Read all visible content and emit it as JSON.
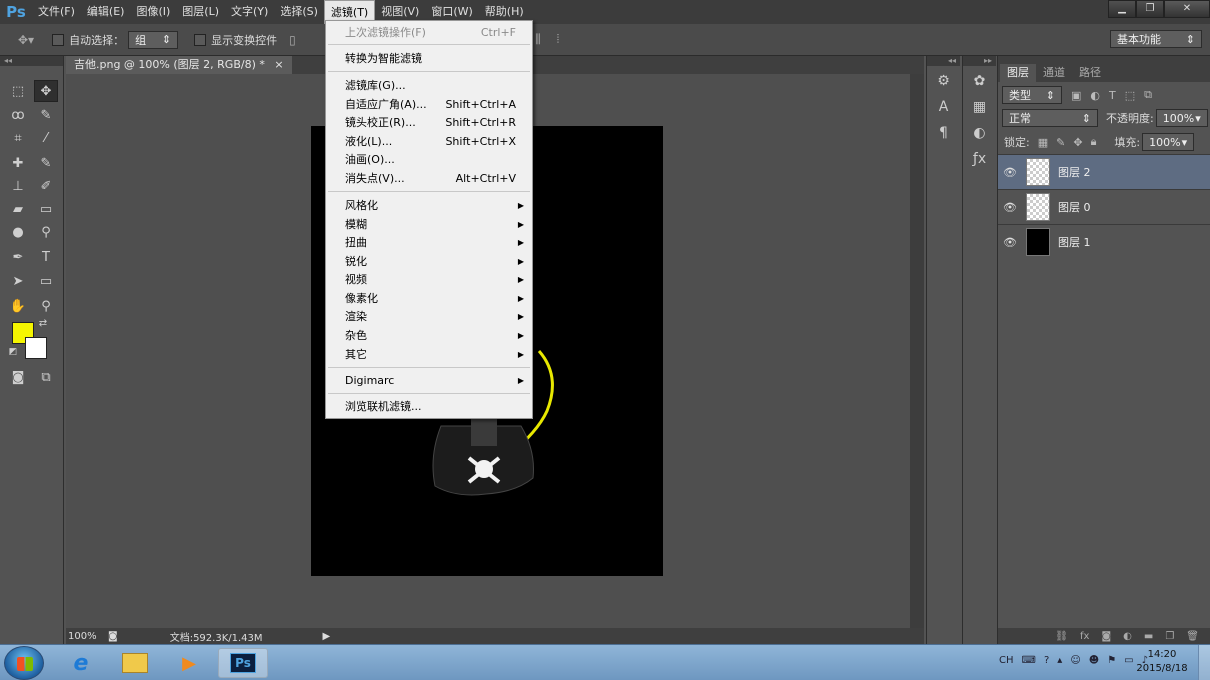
{
  "app": {
    "logo": "Ps"
  },
  "menubar": {
    "items": [
      "文件(F)",
      "编辑(E)",
      "图像(I)",
      "图层(L)",
      "文字(Y)",
      "选择(S)",
      "滤镜(T)",
      "视图(V)",
      "窗口(W)",
      "帮助(H)"
    ],
    "active_index": 6
  },
  "options": {
    "auto_select_label": "自动选择：",
    "auto_select_value": "组",
    "show_transform_label": "显示变换控件",
    "workspace": "基本功能"
  },
  "document": {
    "tab_title": "吉他.png @ 100% (图层 2, RGB/8) *"
  },
  "status": {
    "zoom": "100%",
    "doc_size": "文档:592.3K/1.43M"
  },
  "filter_menu": {
    "last_filter": {
      "label": "上次滤镜操作(F)",
      "shortcut": "Ctrl+F"
    },
    "convert_smart": "转换为智能滤镜",
    "group1": [
      {
        "label": "滤镜库(G)...",
        "shortcut": ""
      },
      {
        "label": "自适应广角(A)...",
        "shortcut": "Shift+Ctrl+A"
      },
      {
        "label": "镜头校正(R)...",
        "shortcut": "Shift+Ctrl+R"
      },
      {
        "label": "液化(L)...",
        "shortcut": "Shift+Ctrl+X"
      },
      {
        "label": "油画(O)...",
        "shortcut": ""
      },
      {
        "label": "消失点(V)...",
        "shortcut": "Alt+Ctrl+V"
      }
    ],
    "submenus": [
      "风格化",
      "模糊",
      "扭曲",
      "锐化",
      "视频",
      "像素化",
      "渲染",
      "杂色",
      "其它"
    ],
    "digimarc": "Digimarc",
    "browse_online": "浏览联机滤镜..."
  },
  "layers_panel": {
    "tabs": [
      "图层",
      "通道",
      "路径"
    ],
    "filter_kind": "类型",
    "blend_mode": "正常",
    "opacity_label": "不透明度:",
    "opacity_value": "100%",
    "lock_label": "锁定:",
    "fill_label": "填充:",
    "fill_value": "100%",
    "layers": [
      {
        "name": "图层 2",
        "selected": true
      },
      {
        "name": "图层 0",
        "selected": false
      },
      {
        "name": "图层 1",
        "selected": false
      }
    ]
  },
  "taskbar": {
    "ps_label": "Ps",
    "ime": "CH",
    "time": "14:20",
    "date": "2015/8/18"
  },
  "colors": {
    "foreground": "#f5f500",
    "background": "#ffffff",
    "accent": "#4fa3e0"
  }
}
